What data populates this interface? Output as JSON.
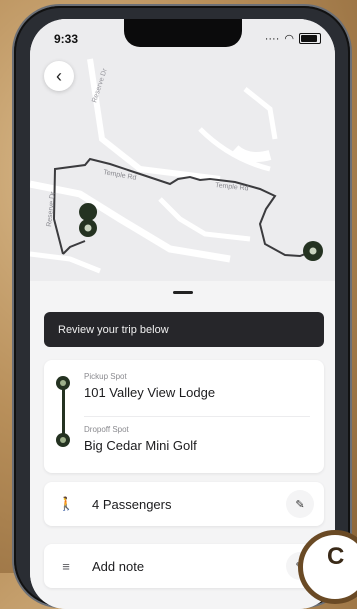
{
  "status_bar": {
    "time": "9:33",
    "signal": "····"
  },
  "map": {
    "road_labels": [
      "Reserve Dr",
      "Temple Rd",
      "Temple Rd",
      "Reserve Dr"
    ]
  },
  "header": {
    "back_icon": "chevron-left-icon"
  },
  "review_banner": {
    "text": "Review your trip below"
  },
  "route": {
    "pickup_label": "Pickup Spot",
    "pickup_value": "101 Valley View Lodge",
    "dropoff_label": "Dropoff Spot",
    "dropoff_value": "Big Cedar Mini Golf"
  },
  "passengers": {
    "label": "4 Passengers",
    "icon": "person-icon",
    "edit_icon": "pencil-icon"
  },
  "note": {
    "label": "Add note",
    "icon": "note-lines-icon",
    "edit_icon": "pencil-icon"
  },
  "colors": {
    "route": "#243221",
    "banner": "#26262a",
    "map_bg": "#ececee"
  }
}
